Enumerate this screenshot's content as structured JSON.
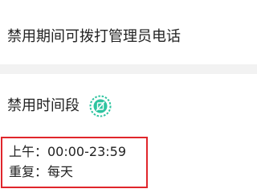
{
  "settings": {
    "allow_admin_call_label": "禁用期间可拨打管理员电话"
  },
  "disable_period": {
    "title": "禁用时间段",
    "icon": "timer-edit-icon",
    "icon_color": "#2ec4a0",
    "schedule": {
      "time_label": "上午：00:00-23:59",
      "repeat_label": "重复：每天"
    }
  },
  "colors": {
    "highlight_border": "#e0262c",
    "background": "#f2f2f2"
  }
}
